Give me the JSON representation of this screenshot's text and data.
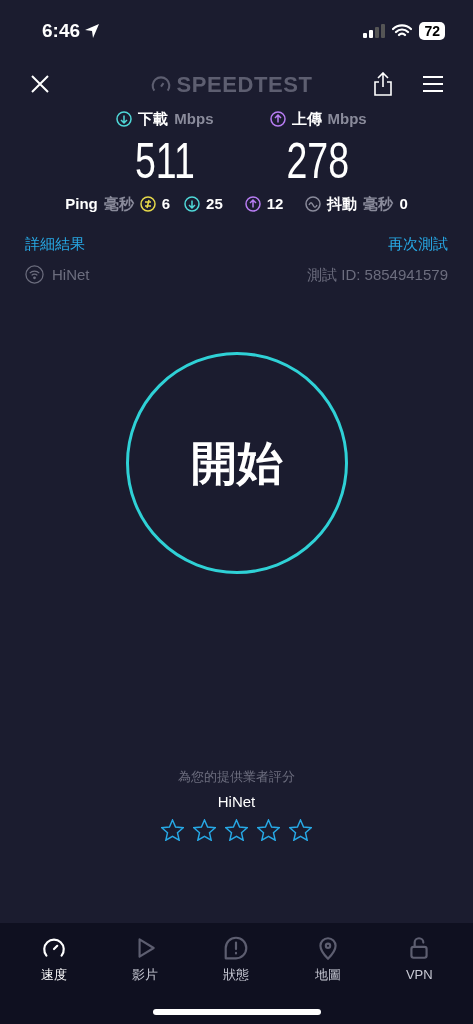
{
  "status_bar": {
    "time": "6:46",
    "battery": "72"
  },
  "header": {
    "logo": "SPEEDTEST"
  },
  "results": [
    {
      "kind": "download",
      "label": "下載",
      "unit": "Mbps",
      "value": "511"
    },
    {
      "kind": "upload",
      "label": "上傳",
      "unit": "Mbps",
      "value": "278"
    }
  ],
  "ping": {
    "label": "Ping",
    "unit": "毫秒",
    "idle": "6",
    "download": "25",
    "upload": "12",
    "jitter_label": "抖動",
    "jitter_unit": "毫秒",
    "jitter": "0"
  },
  "links": {
    "details": "詳細結果",
    "retest": "再次測試"
  },
  "provider": "HiNet",
  "test_id": "測試 ID: 5854941579",
  "start_button": "開始",
  "rating": {
    "prompt": "為您的提供業者評分",
    "provider": "HiNet",
    "stars": 0
  },
  "tabs": [
    {
      "label": "速度",
      "selected": true
    },
    {
      "label": "影片",
      "selected": false
    },
    {
      "label": "狀態",
      "selected": false
    },
    {
      "label": "地圖",
      "selected": false
    },
    {
      "label": "VPN",
      "selected": false
    }
  ]
}
